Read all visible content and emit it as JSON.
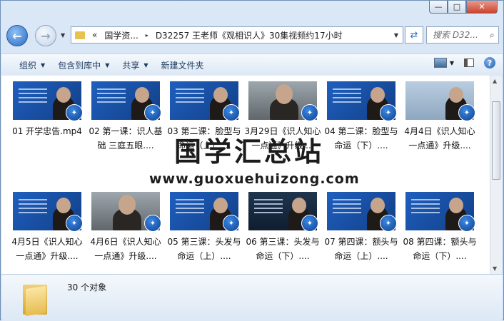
{
  "window": {
    "minimize_glyph": "—",
    "maximize_glyph": "□",
    "close_glyph": "✕"
  },
  "nav": {
    "back_glyph": "←",
    "forward_glyph": "→",
    "dropdown_glyph": "▼",
    "breadcrumb_prefix": "«",
    "breadcrumb": [
      "国学资...",
      "D32257 王老师《观相识人》30集视频约17小时"
    ],
    "breadcrumb_separator": "▸",
    "address_dropdown_glyph": "▼",
    "refresh_glyph": "⇄",
    "search_placeholder": "搜索 D32...",
    "search_icon": "search-icon"
  },
  "toolbar": {
    "items": [
      {
        "label": "组织",
        "has_menu": true
      },
      {
        "label": "包含到库中",
        "has_menu": true
      },
      {
        "label": "共享",
        "has_menu": true
      },
      {
        "label": "新建文件夹",
        "has_menu": false
      }
    ],
    "menu_arrow": "▼",
    "help_glyph": "?"
  },
  "files": [
    {
      "name": "01 开学忠告.mp4",
      "style": "blue"
    },
    {
      "name": "02 第一课：识人基础 三庭五眼....",
      "style": "blue"
    },
    {
      "name": "03 第二课：脸型与命运（上）....",
      "style": "blue"
    },
    {
      "name": "3月29日《识人知心一点通》升级....",
      "style": "studio"
    },
    {
      "name": "04 第二课：脸型与命运（下）....",
      "style": "blue"
    },
    {
      "name": "4月4日《识人知心一点通》升级....",
      "style": "pale"
    },
    {
      "name": "4月5日《识人知心一点通》升级....",
      "style": "blue"
    },
    {
      "name": "4月6日《识人知心一点通》升级....",
      "style": "studio"
    },
    {
      "name": "05 第三课：头发与命运（上）....",
      "style": "blue"
    },
    {
      "name": "06 第三课：头发与命运（下）....",
      "style": "dark"
    },
    {
      "name": "07 第四课：额头与命运（上）....",
      "style": "blue"
    },
    {
      "name": "08 第四课：额头与命运（下）....",
      "style": "blue"
    }
  ],
  "video_badge_glyph": "✦",
  "watermark": {
    "title": "国学汇总站",
    "url": "www.guoxuehuizong.com"
  },
  "details": {
    "count_text": "30 个对象"
  },
  "scrollbar": {
    "up_glyph": "▲",
    "down_glyph": "▼"
  }
}
